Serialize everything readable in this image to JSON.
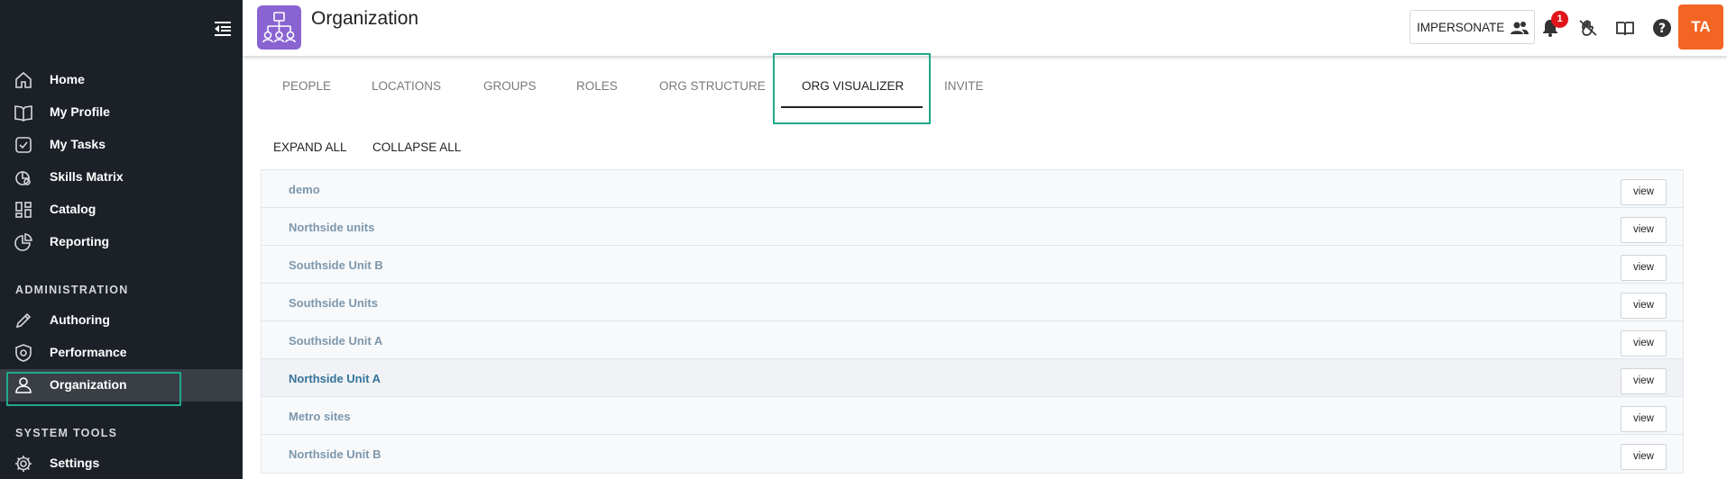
{
  "sidebar": {
    "items": [
      {
        "label": "Home",
        "icon": "home-icon"
      },
      {
        "label": "My Profile",
        "icon": "book-icon"
      },
      {
        "label": "My Tasks",
        "icon": "checkbox-icon"
      },
      {
        "label": "Skills Matrix",
        "icon": "skills-icon"
      },
      {
        "label": "Catalog",
        "icon": "grid-icon"
      },
      {
        "label": "Reporting",
        "icon": "pie-chart-icon"
      }
    ],
    "administration_heading": "ADMINISTRATION",
    "admin_items": [
      {
        "label": "Authoring",
        "icon": "pencil-icon"
      },
      {
        "label": "Performance",
        "icon": "shield-gear-icon"
      },
      {
        "label": "Organization",
        "icon": "person-icon",
        "active": true
      }
    ],
    "system_tools_heading": "SYSTEM TOOLS",
    "system_items": [
      {
        "label": "Settings",
        "icon": "gear-icon"
      }
    ]
  },
  "header": {
    "title": "Organization",
    "impersonate_label": "IMPERSONATE",
    "notification_count": "1",
    "avatar_initials": "TA"
  },
  "tabs": [
    {
      "label": "PEOPLE"
    },
    {
      "label": "LOCATIONS"
    },
    {
      "label": "GROUPS"
    },
    {
      "label": "ROLES"
    },
    {
      "label": "ORG STRUCTURE"
    },
    {
      "label": "ORG VISUALIZER",
      "active": true
    },
    {
      "label": "INVITE"
    }
  ],
  "actions": {
    "expand_all": "EXPAND ALL",
    "collapse_all": "COLLAPSE ALL"
  },
  "org_units": [
    {
      "name": "demo",
      "button": "view"
    },
    {
      "name": "Northside units",
      "button": "view"
    },
    {
      "name": "Southside Unit B",
      "button": "view"
    },
    {
      "name": "Southside Units",
      "button": "view"
    },
    {
      "name": "Southside Unit A",
      "button": "view"
    },
    {
      "name": "Northside Unit A",
      "button": "view",
      "highlighted": true
    },
    {
      "name": "Metro sites",
      "button": "view"
    },
    {
      "name": "Northside Unit B",
      "button": "view"
    }
  ],
  "colors": {
    "sidebar_bg": "#1c2128",
    "accent_outline": "#1fa98a",
    "app_icon_bg": "#8a63d2",
    "avatar_bg": "#f26522",
    "badge_bg": "#e0151b"
  }
}
